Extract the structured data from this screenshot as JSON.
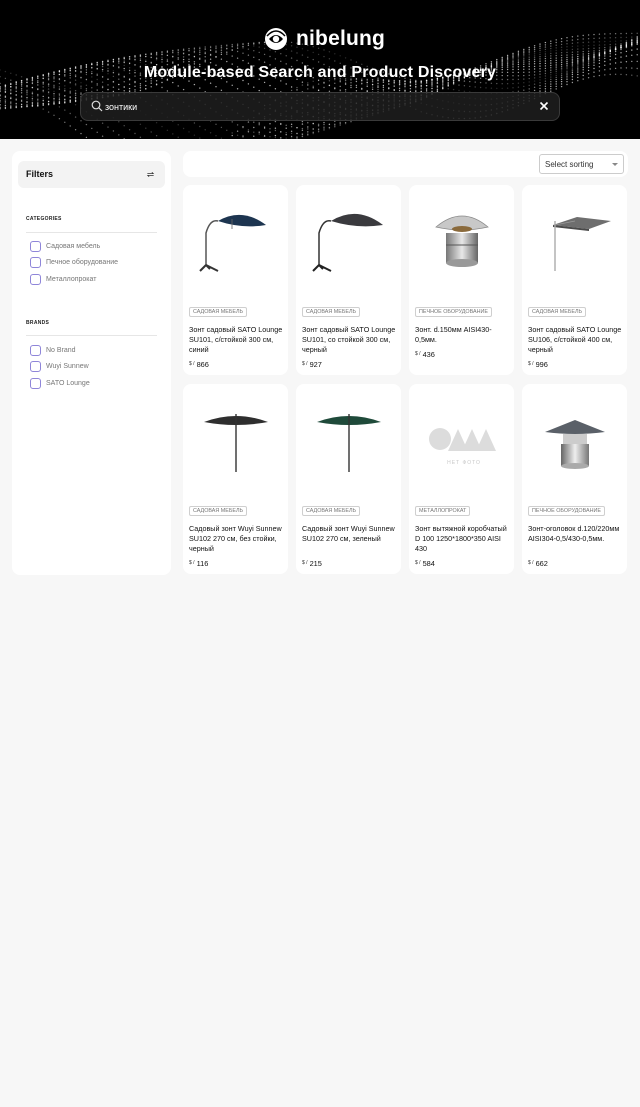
{
  "brand": {
    "name": "nibelung"
  },
  "hero": {
    "title": "Module-based Search and Product Discovery"
  },
  "search": {
    "value": "зонтики",
    "placeholder": ""
  },
  "filters": {
    "title": "Filters",
    "categories_title": "CATEGORIES",
    "categories": [
      "Садовая мебель",
      "Печное оборудование",
      "Металлопрокат"
    ],
    "brands_title": "BRANDS",
    "brands": [
      "No Brand",
      "Wuyi Sunnew",
      "SATO Lounge"
    ]
  },
  "sort": {
    "label": "Select sorting"
  },
  "products": [
    {
      "category": "САДОВАЯ МЕБЕЛЬ",
      "title": "Зонт садовый SATO Lounge SU101, с/стойкой 300 см, синий",
      "currency": "$ /",
      "price": "866",
      "image": "cantilever-umbrella-blue"
    },
    {
      "category": "САДОВАЯ МЕБЕЛЬ",
      "title": "Зонт садовый SATO Lounge SU101, со стойкой 300 см, черный",
      "currency": "$ /",
      "price": "927",
      "image": "cantilever-umbrella-black"
    },
    {
      "category": "ПЕЧНОЕ ОБОРУДОВАНИЕ",
      "title": "Зонт. d.150мм AISI430-0,5мм.",
      "currency": "$ /",
      "price": "436",
      "image": "chimney-cap"
    },
    {
      "category": "САДОВАЯ МЕБЕЛЬ",
      "title": "Зонт садовый SATO Lounge SU106, с/стойкой 400 см, черный",
      "currency": "$ /",
      "price": "996",
      "image": "square-umbrella-grey"
    },
    {
      "category": "САДОВАЯ МЕБЕЛЬ",
      "title": "Садовый зонт Wuyi Sunnew SU102 270 см, без стойки, черный",
      "currency": "$ /",
      "price": "116",
      "image": "market-umbrella-black"
    },
    {
      "category": "САДОВАЯ МЕБЕЛЬ",
      "title": "Садовый зонт Wuyi Sunnew SU102 270 см, зеленый",
      "currency": "$ /",
      "price": "215",
      "image": "market-umbrella-green"
    },
    {
      "category": "МЕТАЛЛОПРОКАТ",
      "title": "Зонт вытяжной коробчатый D 100 1250*1800*350 AISI 430",
      "currency": "$ /",
      "price": "584",
      "image": "no-photo",
      "placeholder_text": "НЕТ ФОТО"
    },
    {
      "category": "ПЕЧНОЕ ОБОРУДОВАНИЕ",
      "title": "Зонт-оголовок d.120/220мм AISI304-0,5/430-0,5мм.",
      "currency": "$ /",
      "price": "662",
      "image": "chimney-cap-cone"
    }
  ],
  "colors": {
    "hero_bg": "#000000",
    "checkbox_border": "#8f86d9",
    "page_bg": "#f7f7f7"
  }
}
